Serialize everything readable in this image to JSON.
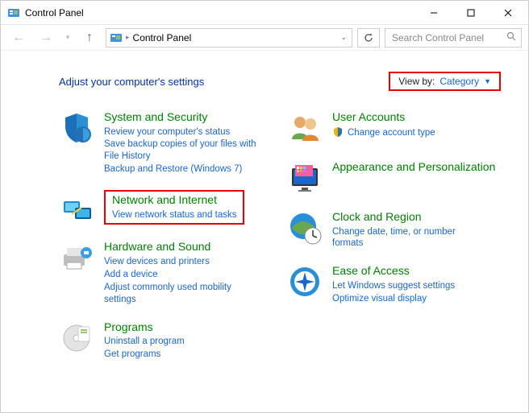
{
  "window": {
    "title": "Control Panel"
  },
  "nav": {
    "breadcrumb": "Control Panel",
    "search_placeholder": "Search Control Panel"
  },
  "header": {
    "heading": "Adjust your computer's settings",
    "viewby_label": "View by:",
    "viewby_value": "Category"
  },
  "left": {
    "cat0": {
      "title": "System and Security",
      "l0": "Review your computer's status",
      "l1": "Save backup copies of your files with File History",
      "l2": "Backup and Restore (Windows 7)"
    },
    "cat1": {
      "title": "Network and Internet",
      "l0": "View network status and tasks"
    },
    "cat2": {
      "title": "Hardware and Sound",
      "l0": "View devices and printers",
      "l1": "Add a device",
      "l2": "Adjust commonly used mobility settings"
    },
    "cat3": {
      "title": "Programs",
      "l0": "Uninstall a program",
      "l1": "Get programs"
    }
  },
  "right": {
    "cat0": {
      "title": "User Accounts",
      "l0": "Change account type"
    },
    "cat1": {
      "title": "Appearance and Personalization"
    },
    "cat2": {
      "title": "Clock and Region",
      "l0": "Change date, time, or number formats"
    },
    "cat3": {
      "title": "Ease of Access",
      "l0": "Let Windows suggest settings",
      "l1": "Optimize visual display"
    }
  }
}
